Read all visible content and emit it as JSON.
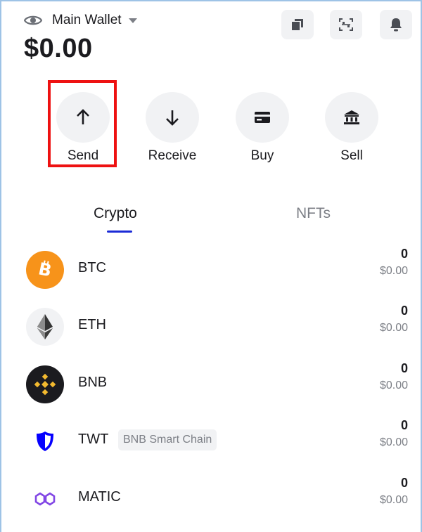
{
  "header": {
    "wallet_name": "Main Wallet",
    "balance": "$0.00",
    "buttons": [
      "copy-icon",
      "scan-icon",
      "bell-icon"
    ]
  },
  "actions": [
    {
      "label": "Send",
      "icon": "arrow-up-icon"
    },
    {
      "label": "Receive",
      "icon": "arrow-down-icon"
    },
    {
      "label": "Buy",
      "icon": "card-icon"
    },
    {
      "label": "Sell",
      "icon": "bank-icon"
    }
  ],
  "tabs": {
    "crypto": "Crypto",
    "nfts": "NFTs",
    "active": "Crypto"
  },
  "tokens": [
    {
      "symbol": "BTC",
      "amount": "0",
      "fiat": "$0.00",
      "chain": ""
    },
    {
      "symbol": "ETH",
      "amount": "0",
      "fiat": "$0.00",
      "chain": ""
    },
    {
      "symbol": "BNB",
      "amount": "0",
      "fiat": "$0.00",
      "chain": ""
    },
    {
      "symbol": "TWT",
      "amount": "0",
      "fiat": "$0.00",
      "chain": "BNB Smart Chain"
    },
    {
      "symbol": "MATIC",
      "amount": "0",
      "fiat": "$0.00",
      "chain": ""
    }
  ],
  "colors": {
    "btc": "#f7931a",
    "bnb": "#f3ba2f",
    "twt": "#0500ff",
    "matic": "#8247e5",
    "tab_accent": "#1b2bd6",
    "highlight": "#ee1111"
  }
}
